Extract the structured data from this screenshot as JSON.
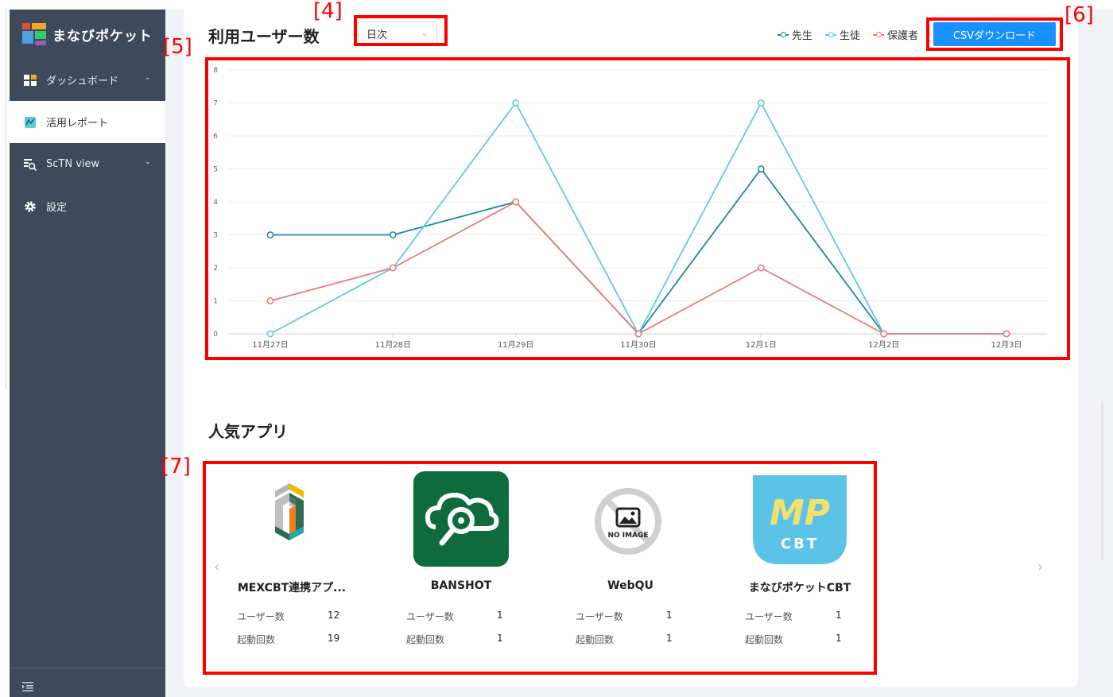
{
  "brand": {
    "name": "まなびポケット"
  },
  "sidebar": {
    "items": [
      {
        "label": "ダッシュボード",
        "icon": "dashboard-icon",
        "has_chevron": true
      },
      {
        "label": "活用レポート",
        "icon": "report-icon",
        "active": true
      },
      {
        "label": "ScTN view",
        "icon": "sctn-view-icon",
        "has_chevron": true
      },
      {
        "label": "設定",
        "icon": "gear-icon"
      }
    ]
  },
  "users_section": {
    "title": "利用ユーザー数",
    "period_select": {
      "value": "日次"
    },
    "legend": [
      {
        "label": "先生",
        "color": "#1a8a9e"
      },
      {
        "label": "生徒",
        "color": "#5ccbdc"
      },
      {
        "label": "保護者",
        "color": "#ec7b79"
      }
    ],
    "csv_button": "CSVダウンロード"
  },
  "chart_data": {
    "type": "line",
    "categories": [
      "11月27日",
      "11月28日",
      "11月29日",
      "11月30日",
      "12月1日",
      "12月2日",
      "12月3日"
    ],
    "ylim": [
      0,
      8
    ],
    "yticks": [
      "0",
      "1",
      "2",
      "3",
      "4",
      "5",
      "6",
      "7",
      "8"
    ],
    "grid": true,
    "series": [
      {
        "name": "先生",
        "color": "#1a8a9e",
        "values": [
          3,
          3,
          4,
          0,
          5,
          0,
          0
        ]
      },
      {
        "name": "生徒",
        "color": "#5ccbdc",
        "values": [
          0,
          2,
          7,
          0,
          7,
          0,
          0
        ]
      },
      {
        "name": "保護者",
        "color": "#ec7b79",
        "values": [
          1,
          2,
          4,
          0,
          2,
          0,
          0
        ]
      }
    ]
  },
  "apps_section": {
    "title": "人気アプリ",
    "stat_labels": {
      "users": "ユーザー数",
      "launches": "起動回数"
    },
    "apps": [
      {
        "name": "MEXCBT連携アプ...",
        "icon": "mexcbt-logo-icon",
        "users": "12",
        "launches": "19"
      },
      {
        "name": "BANSHOT",
        "icon": "banshot-cloud-search-icon",
        "users": "1",
        "launches": "1"
      },
      {
        "name": "WebQU",
        "icon": "no-image-icon",
        "icon_text": "NO IMAGE",
        "users": "1",
        "launches": "1"
      },
      {
        "name": "まなびポケットCBT",
        "icon": "mp-cbt-logo-icon",
        "icon_text_top": "MP",
        "icon_text_bottom": "CBT",
        "users": "1",
        "launches": "1"
      }
    ]
  },
  "annotations": [
    {
      "label": "[4]",
      "color": "#ff0000"
    },
    {
      "label": "[5]",
      "color": "#ff0000"
    },
    {
      "label": "[6]",
      "color": "#ff0000"
    },
    {
      "label": "[7]",
      "color": "#ff0000"
    }
  ]
}
